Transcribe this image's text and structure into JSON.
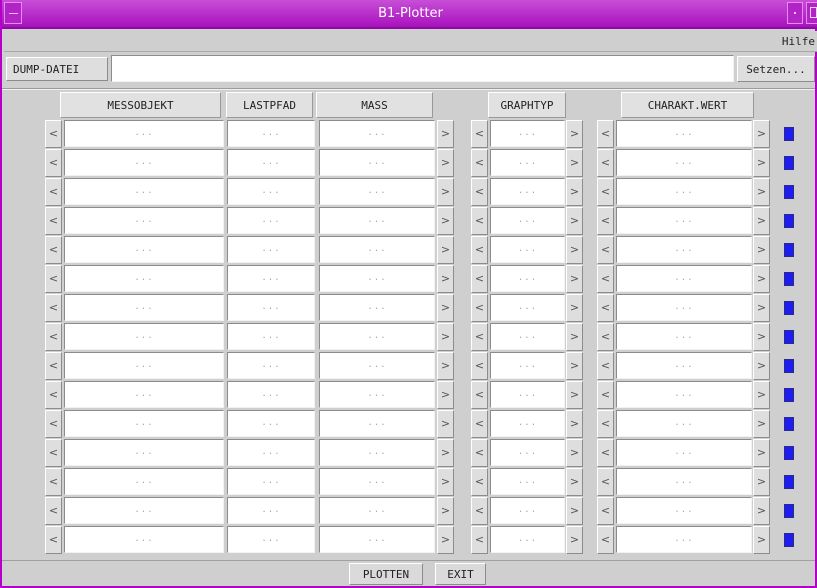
{
  "window": {
    "title": "B1-Plotter"
  },
  "menu": {
    "help": "Hilfe"
  },
  "dump": {
    "label": "DUMP-DATEI",
    "value": "",
    "set_button": "Setzen..."
  },
  "headers": {
    "messobjekt": "MESSOBJEKT",
    "lastpfad": "LASTPFAD",
    "mass": "MASS",
    "graphtyp": "GRAPHTYP",
    "charakt": "CHARAKT.WERT"
  },
  "rows": [
    {
      "messobjekt": "...",
      "lastpfad": "...",
      "mass": "...",
      "graphtyp": "...",
      "charakt": "..."
    },
    {
      "messobjekt": "...",
      "lastpfad": "...",
      "mass": "...",
      "graphtyp": "...",
      "charakt": "..."
    },
    {
      "messobjekt": "...",
      "lastpfad": "...",
      "mass": "...",
      "graphtyp": "...",
      "charakt": "..."
    },
    {
      "messobjekt": "...",
      "lastpfad": "...",
      "mass": "...",
      "graphtyp": "...",
      "charakt": "..."
    },
    {
      "messobjekt": "...",
      "lastpfad": "...",
      "mass": "...",
      "graphtyp": "...",
      "charakt": "..."
    },
    {
      "messobjekt": "...",
      "lastpfad": "...",
      "mass": "...",
      "graphtyp": "...",
      "charakt": "..."
    },
    {
      "messobjekt": "...",
      "lastpfad": "...",
      "mass": "...",
      "graphtyp": "...",
      "charakt": "..."
    },
    {
      "messobjekt": "...",
      "lastpfad": "...",
      "mass": "...",
      "graphtyp": "...",
      "charakt": "..."
    },
    {
      "messobjekt": "...",
      "lastpfad": "...",
      "mass": "...",
      "graphtyp": "...",
      "charakt": "..."
    },
    {
      "messobjekt": "...",
      "lastpfad": "...",
      "mass": "...",
      "graphtyp": "...",
      "charakt": "..."
    },
    {
      "messobjekt": "...",
      "lastpfad": "...",
      "mass": "...",
      "graphtyp": "...",
      "charakt": "..."
    },
    {
      "messobjekt": "...",
      "lastpfad": "...",
      "mass": "...",
      "graphtyp": "...",
      "charakt": "..."
    },
    {
      "messobjekt": "...",
      "lastpfad": "...",
      "mass": "...",
      "graphtyp": "...",
      "charakt": "..."
    },
    {
      "messobjekt": "...",
      "lastpfad": "...",
      "mass": "...",
      "graphtyp": "...",
      "charakt": "..."
    },
    {
      "messobjekt": "...",
      "lastpfad": "...",
      "mass": "...",
      "graphtyp": "...",
      "charakt": "..."
    }
  ],
  "glyphs": {
    "prev": "<",
    "next": ">"
  },
  "buttons": {
    "plot": "PLOTTEN",
    "exit": "EXIT"
  },
  "colors": {
    "titlebar": "#b01ec4",
    "frame": "#b500c8",
    "status_led": "#1f1cf0",
    "background": "#cfcfcf"
  }
}
